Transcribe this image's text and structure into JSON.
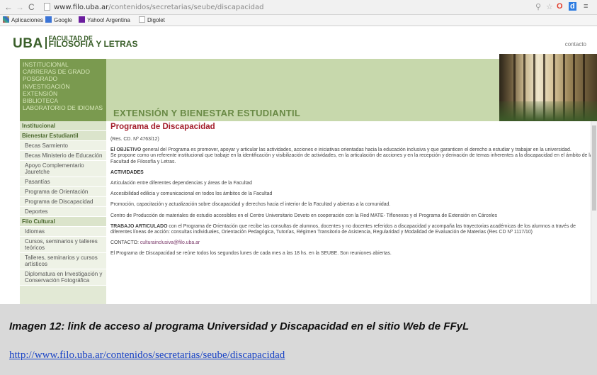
{
  "browser": {
    "url_host": "www.filo.uba.ar",
    "url_path": "/contenidos/secretarias/seube/discapacidad",
    "bookmarks": [
      "Aplicaciones",
      "Google",
      "Yahoo! Argentina",
      "Digolet"
    ]
  },
  "site": {
    "logo_uba": "UBA",
    "logo_fac_line1": "FACULTAD DE",
    "logo_fac_line2": "FILOSOFIA Y LETRAS",
    "contact_link": "contacto",
    "top_menu": [
      "INSTITUCIONAL",
      "CARRERAS DE GRADO",
      "POSGRADO",
      "INVESTIGACIÓN",
      "EXTENSIÓN",
      "BIBLIOTECA",
      "LABORATORIO DE IDIOMAS"
    ],
    "banner_title": "EXTENSIÓN Y BIENESTAR ESTUDIANTIL"
  },
  "sidebar": {
    "items": [
      {
        "label": "Institucional",
        "kind": "head"
      },
      {
        "label": "Bienestar Estudiantil",
        "kind": "head"
      },
      {
        "label": "Becas Sarmiento",
        "kind": "sub"
      },
      {
        "label": "Becas Ministerio de Educación",
        "kind": "sub"
      },
      {
        "label": "Apoyo Complementario Jauretche",
        "kind": "sub"
      },
      {
        "label": "Pasantías",
        "kind": "sub"
      },
      {
        "label": "Programa de Orientación",
        "kind": "sub"
      },
      {
        "label": "Programa de Discapacidad",
        "kind": "sub"
      },
      {
        "label": "Deportes",
        "kind": "sub"
      },
      {
        "label": "Filo Cultural",
        "kind": "head"
      },
      {
        "label": "Idiomas",
        "kind": "sub"
      },
      {
        "label": "Cursos, seminarios y talleres teóricos",
        "kind": "sub"
      },
      {
        "label": "Talleres, seminarios y cursos artísticos",
        "kind": "sub"
      },
      {
        "label": "Diplomatura en Investigación y Conservación Fotográfica",
        "kind": "sub"
      }
    ]
  },
  "content": {
    "title": "Programa de Discapacidad",
    "resolution": "(Res. CD. Nº 4763/12)",
    "objective_lead": "El OBJETIVO",
    "objective_text": " general del Programa es promover, apoyar y articular las actividades, acciones e iniciativas orientadas hacia la educación inclusiva y que garanticen el derecho a estudiar y trabajar en la universidad.",
    "proposal": "Se propone como un referente institucional que trabaje en la identificación y visibilización de actividades, en la articulación de acciones y en la recepción y derivación de temas inherentes a la discapacidad en el ámbito de la Facultad de Filosofía y Letras.",
    "activities_heading": "ACTIVIDADES",
    "activities": [
      "Articulación entre diferentes dependencias y áreas de la Facultad",
      "Accesibilidad edilicia y comunicacional en todos los ámbitos de la Facultad",
      "Promoción, capacitación y actualización sobre discapacidad y derechos hacia el interior de la Facultad y abiertas a la comunidad.",
      "Centro de Producción de materiales de estudio accesibles en el Centro Universitario Devoto en cooperación con la Red MATE- Tiflonexos y el Programa de Extensión en Cárceles"
    ],
    "joint_lead": "TRABAJO ARTICULADO",
    "joint_text": " con el Programa de Orientación que recibe las consultas de alumnos, docentes y no docentes referidos a discapacidad y acompaña las trayectorias académicas de los alumnos a través de diferentes líneas de acción: consultas individuales, Orientación Pedagógica, Tutorías, Régimen Transitorio de Asistencia, Regularidad y Modalidad de Evaluación de Materias (Res CD Nº 1117/10)",
    "contact_label": "CONTACTO: ",
    "contact_email": "culturainclusiva@filo.uba.ar",
    "meeting": "El Programa de Discapacidad se reúne todos los segundos lunes de cada mes a las 18 hs. en la SEUBE. Son reuniones abiertas."
  },
  "caption": {
    "text": "Imagen 12: link de acceso al programa Universidad y Discapacidad en el sitio Web de FFyL",
    "link": "http://www.filo.uba.ar/contenidos/secretarias/seube/discapacidad"
  }
}
